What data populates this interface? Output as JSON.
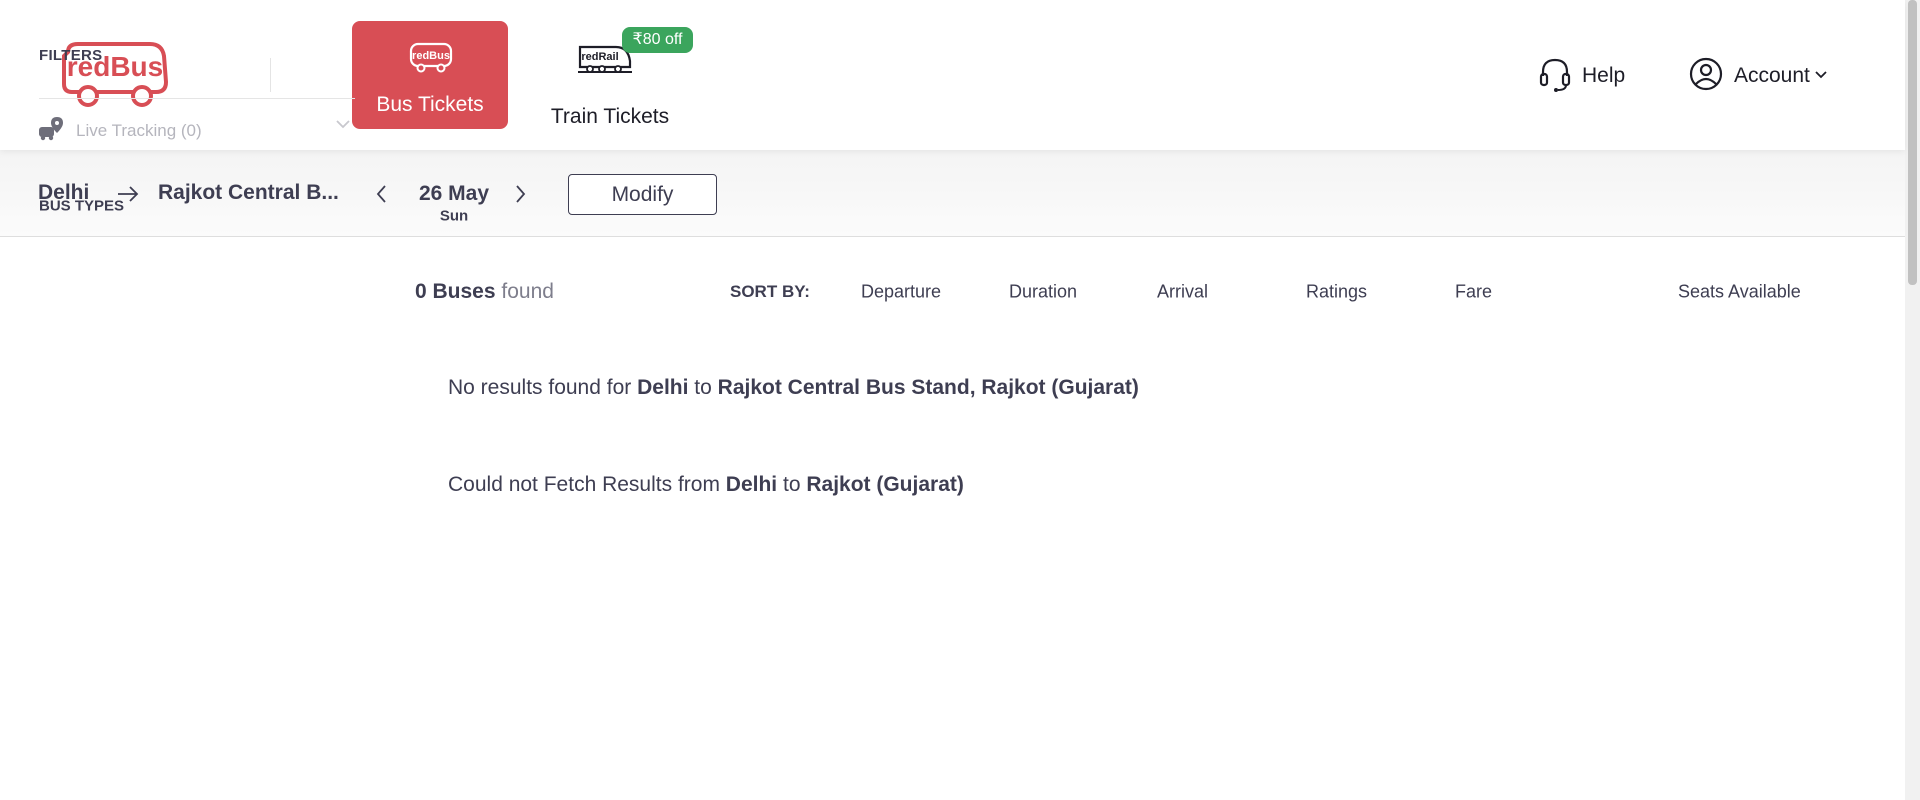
{
  "brand": {
    "logo_text": "redBus",
    "accent": "#d84e55",
    "offer_green": "#3ba55d"
  },
  "header": {
    "tabs": [
      {
        "label": "Bus Tickets",
        "icon_text": "redBus",
        "active": true
      },
      {
        "label": "Train Tickets",
        "icon_text": "redRail",
        "active": false
      }
    ],
    "offer_badge": "₹80 off",
    "help": "Help",
    "account": "Account"
  },
  "sidebar": {
    "filters_label": "FILTERS",
    "live_tracking": "Live Tracking (0)",
    "bus_types_label": "BUS TYPES"
  },
  "search": {
    "from": "Delhi",
    "to": "Rajkot Central B...",
    "date": "26 May",
    "day": "Sun",
    "modify_label": "Modify"
  },
  "results": {
    "count": "0 Buses",
    "count_suffix": "found",
    "sort_label": "SORT BY:",
    "sort_options": [
      "Departure",
      "Duration",
      "Arrival",
      "Ratings",
      "Fare",
      "Seats Available"
    ]
  },
  "messages": {
    "no_results": {
      "prefix": "No results found for",
      "from": "Delhi",
      "joiner": "to",
      "to": "Rajkot Central Bus Stand, Rajkot (Gujarat)"
    },
    "fetch_error": {
      "prefix": "Could not Fetch Results from",
      "from": "Delhi",
      "joiner": "to",
      "to": "Rajkot (Gujarat)"
    }
  },
  "icons": {
    "logo": "redbus-logo-icon",
    "bus_tab": "bus-icon",
    "train_tab": "train-icon",
    "help": "headset-icon",
    "account": "user-circle-icon",
    "account_chevron": "chevron-down-icon",
    "live_tracking": "map-pin-bus-icon",
    "route_arrow": "arrow-right-icon",
    "date_prev": "chevron-left-icon",
    "date_next": "chevron-right-icon"
  }
}
